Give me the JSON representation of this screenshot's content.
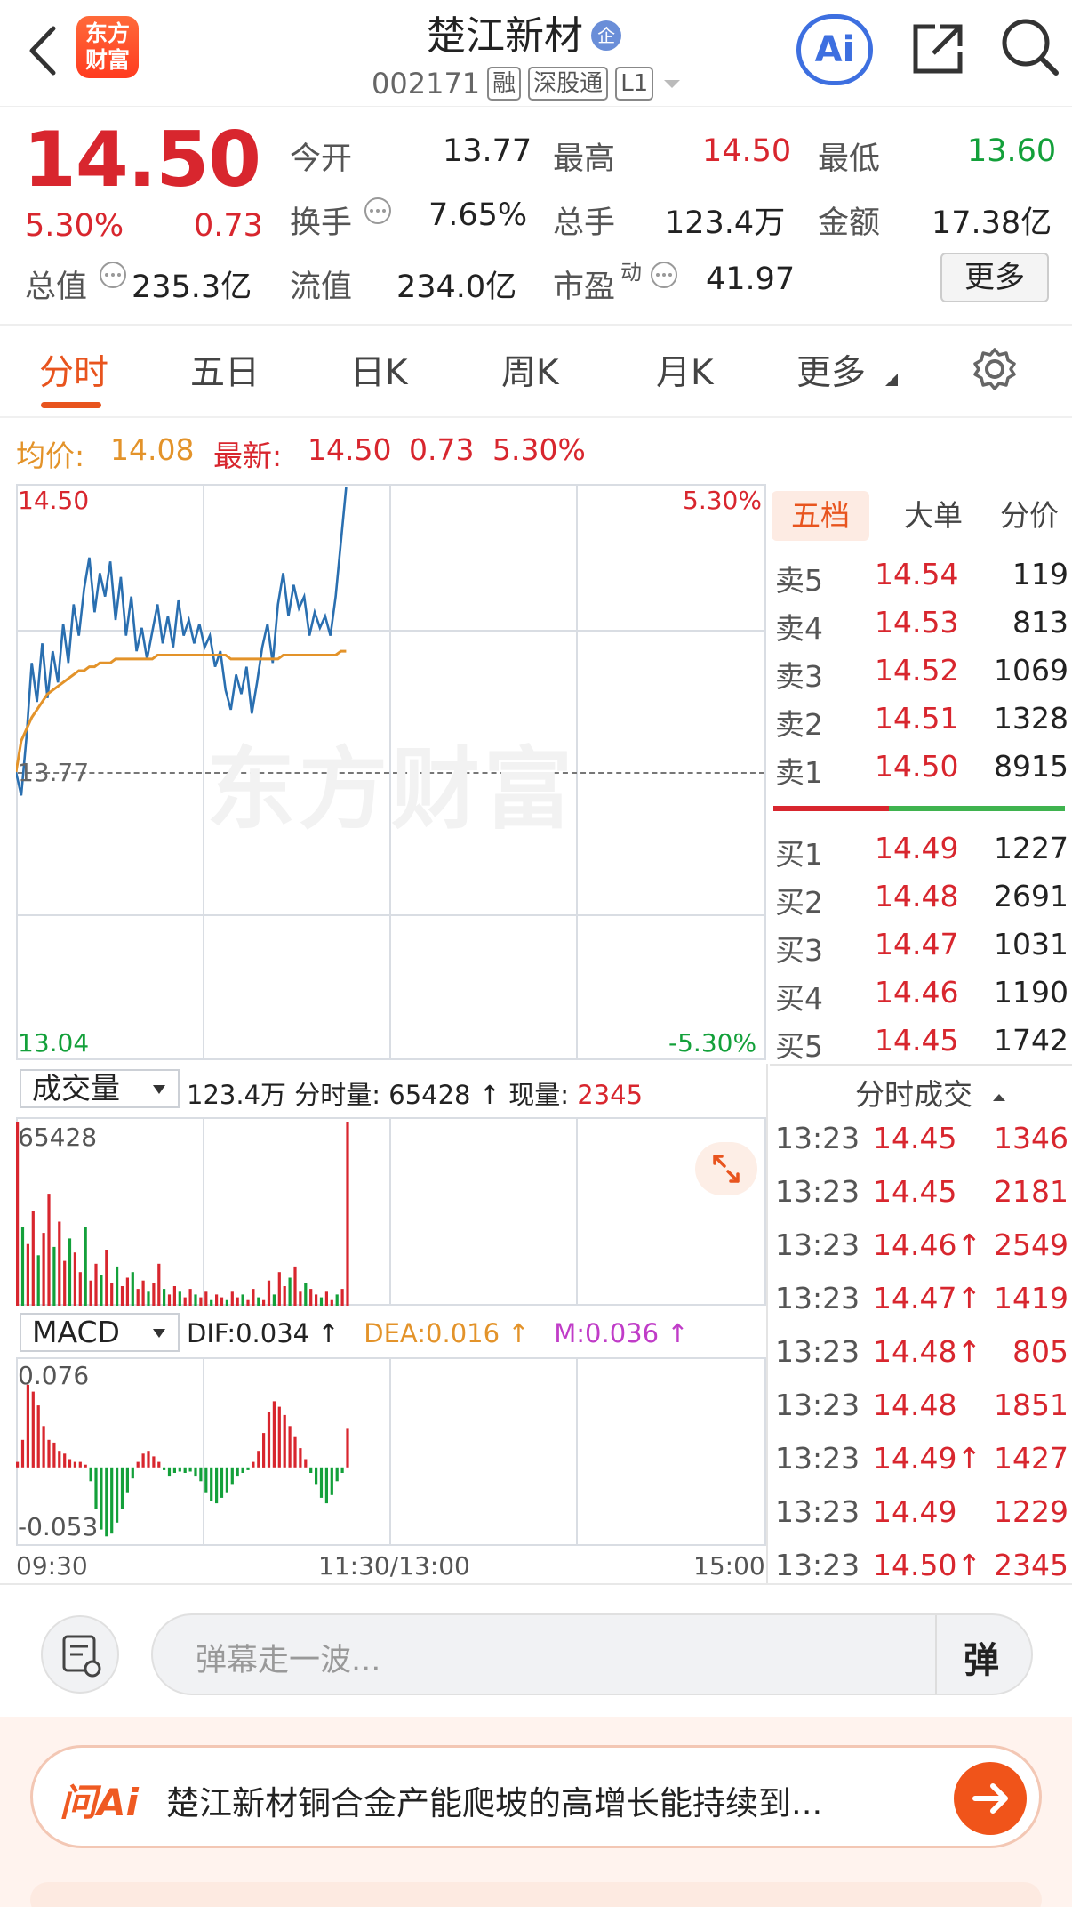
{
  "header": {
    "logo_text_line1": "东方",
    "logo_text_line2": "财富",
    "title": "楚江新材",
    "badge": "企",
    "code": "002171",
    "tags": [
      "融",
      "深股通",
      "L1"
    ],
    "ai_label": "Ai"
  },
  "quote": {
    "price": "14.50",
    "change_pct": "5.30%",
    "change": "0.73",
    "open_label": "今开",
    "open": "13.77",
    "high_label": "最高",
    "high": "14.50",
    "low_label": "最低",
    "low": "13.60",
    "turnover_label": "换手",
    "turnover": "7.65%",
    "volume_label": "总手",
    "volume": "123.4万",
    "amount_label": "金额",
    "amount": "17.38亿",
    "mktcap_label": "总值",
    "mktcap": "235.3亿",
    "float_label": "流值",
    "float": "234.0亿",
    "pe_label": "市盈",
    "pe_sup": "动",
    "pe": "41.97",
    "more_button": "更多"
  },
  "tabs": [
    "分时",
    "五日",
    "日K",
    "周K",
    "月K",
    "更多"
  ],
  "active_tab": "分时",
  "chart_header": {
    "avg_label": "均价:",
    "avg": "14.08",
    "latest_label": "最新:",
    "latest": "14.50",
    "chg": "0.73",
    "pct": "5.30%"
  },
  "chart_labels": {
    "top_price": "14.50",
    "top_pct": "5.30%",
    "mid_price": "13.77",
    "bottom_price": "13.04",
    "bottom_pct": "-5.30%",
    "watermark": "东方财富"
  },
  "colors": {
    "up": "#d8262e",
    "down": "#13a03a",
    "accent": "#e8541e",
    "price_line": "#2a6fb0",
    "avg_line": "#e3932a"
  },
  "chart_data": [
    {
      "type": "line",
      "title": "",
      "ylim": [
        13.04,
        14.5
      ],
      "x_range_labels": [
        "09:30",
        "11:30/13:00",
        "15:00"
      ],
      "series": [
        {
          "values": [
            13.77,
            13.71,
            13.86,
            14.05,
            13.95,
            14.1,
            13.96,
            14.08,
            14.0,
            14.15,
            14.05,
            14.2,
            14.12,
            14.24,
            14.32,
            14.18,
            14.28,
            14.22,
            14.31,
            14.16,
            14.27,
            14.12,
            14.22,
            14.08,
            14.14,
            14.06,
            14.13,
            14.2,
            14.1,
            14.17,
            14.09,
            14.21,
            14.12,
            14.16,
            14.1,
            14.15,
            14.09,
            14.12,
            14.04,
            14.08,
            13.98,
            13.93,
            14.02,
            13.97,
            14.04,
            13.92,
            14.0,
            14.09,
            14.15,
            14.05,
            14.2,
            14.28,
            14.17,
            14.25,
            14.19,
            14.22,
            14.12,
            14.18,
            14.14,
            14.17,
            14.12,
            14.22,
            14.36,
            14.5
          ]
        },
        {
          "values": [
            13.77,
            13.85,
            13.88,
            13.91,
            13.93,
            13.95,
            13.97,
            13.98,
            13.99,
            14.0,
            14.01,
            14.02,
            14.03,
            14.03,
            14.04,
            14.04,
            14.05,
            14.05,
            14.05,
            14.06,
            14.06,
            14.06,
            14.06,
            14.06,
            14.06,
            14.06,
            14.06,
            14.07,
            14.07,
            14.07,
            14.07,
            14.07,
            14.07,
            14.07,
            14.07,
            14.07,
            14.07,
            14.07,
            14.07,
            14.07,
            14.07,
            14.06,
            14.06,
            14.06,
            14.06,
            14.06,
            14.06,
            14.06,
            14.06,
            14.06,
            14.06,
            14.07,
            14.07,
            14.07,
            14.07,
            14.07,
            14.07,
            14.07,
            14.07,
            14.07,
            14.07,
            14.07,
            14.08,
            14.08
          ]
        }
      ]
    },
    {
      "type": "bar",
      "title": "",
      "ylim": [
        0,
        65428
      ],
      "values": [
        65428,
        28000,
        22000,
        34000,
        18000,
        26000,
        40000,
        21000,
        30000,
        16000,
        24000,
        19000,
        12000,
        28000,
        9000,
        15000,
        11000,
        20000,
        8000,
        14000,
        7000,
        10000,
        12000,
        6000,
        9000,
        5000,
        8000,
        15000,
        6000,
        4000,
        7000,
        5000,
        3000,
        6000,
        4000,
        3000,
        5000,
        2000,
        4000,
        3000,
        2000,
        5000,
        3000,
        4000,
        2000,
        6000,
        3000,
        2000,
        9000,
        4000,
        12000,
        7000,
        10000,
        14000,
        5000,
        8000,
        6000,
        4000,
        3000,
        5000,
        2000,
        4000,
        6000,
        65428
      ]
    },
    {
      "type": "bar",
      "title": "",
      "ylim": [
        -0.053,
        0.076
      ],
      "values": [
        0.004,
        0.02,
        0.06,
        0.055,
        0.045,
        0.03,
        0.02,
        0.018,
        0.012,
        0.01,
        0.006,
        0.004,
        0.004,
        0.002,
        -0.01,
        -0.03,
        -0.045,
        -0.05,
        -0.048,
        -0.04,
        -0.03,
        -0.018,
        -0.008,
        0.004,
        0.01,
        0.012,
        0.008,
        0.004,
        -0.002,
        -0.006,
        -0.004,
        -0.003,
        -0.004,
        -0.003,
        -0.006,
        -0.01,
        -0.018,
        -0.024,
        -0.026,
        -0.022,
        -0.018,
        -0.012,
        -0.006,
        -0.004,
        -0.002,
        0.004,
        0.012,
        0.025,
        0.04,
        0.048,
        0.044,
        0.038,
        0.03,
        0.022,
        0.014,
        0.006,
        -0.004,
        -0.012,
        -0.022,
        -0.026,
        -0.02,
        -0.01,
        -0.004,
        0.028
      ]
    }
  ],
  "volume_panel": {
    "select_label": "成交量",
    "total": "123.4万",
    "period_label": "分时量:",
    "period_value": "65428",
    "current_label": "现量:",
    "current_value": "2345",
    "max_label": "65428"
  },
  "macd_panel": {
    "select_label": "MACD",
    "dif": "DIF:0.034",
    "dea": "DEA:0.016",
    "m": "M:0.036",
    "top_label": "0.076",
    "bottom_label": "-0.053"
  },
  "time_axis": {
    "start": "09:30",
    "mid": "11:30/13:00",
    "end": "15:00"
  },
  "orderbook": {
    "tabs": [
      "五档",
      "大单",
      "分价"
    ],
    "sells": [
      {
        "label": "卖5",
        "price": "14.54",
        "vol": "119"
      },
      {
        "label": "卖4",
        "price": "14.53",
        "vol": "813"
      },
      {
        "label": "卖3",
        "price": "14.52",
        "vol": "1069"
      },
      {
        "label": "卖2",
        "price": "14.51",
        "vol": "1328"
      },
      {
        "label": "卖1",
        "price": "14.50",
        "vol": "8915"
      }
    ],
    "buys": [
      {
        "label": "买1",
        "price": "14.49",
        "vol": "1227"
      },
      {
        "label": "买2",
        "price": "14.48",
        "vol": "2691"
      },
      {
        "label": "买3",
        "price": "14.47",
        "vol": "1031"
      },
      {
        "label": "买4",
        "price": "14.46",
        "vol": "1190"
      },
      {
        "label": "买5",
        "price": "14.45",
        "vol": "1742"
      }
    ]
  },
  "trades": {
    "title": "分时成交",
    "rows": [
      {
        "time": "13:23",
        "price": "14.45",
        "vol": "1346"
      },
      {
        "time": "13:23",
        "price": "14.45",
        "vol": "2181"
      },
      {
        "time": "13:23",
        "price": "14.46↑",
        "vol": "2549"
      },
      {
        "time": "13:23",
        "price": "14.47↑",
        "vol": "1419"
      },
      {
        "time": "13:23",
        "price": "14.48↑",
        "vol": "805"
      },
      {
        "time": "13:23",
        "price": "14.48",
        "vol": "1851"
      },
      {
        "time": "13:23",
        "price": "14.49↑",
        "vol": "1427"
      },
      {
        "time": "13:23",
        "price": "14.49",
        "vol": "1229"
      },
      {
        "time": "13:23",
        "price": "14.50↑",
        "vol": "2345"
      }
    ]
  },
  "comment_bar": {
    "placeholder": "弹幕走一波...",
    "send_label": "弹"
  },
  "ai_banner": {
    "logo": "问Ai",
    "text": "楚江新材铜合金产能爬坡的高增长能持续到..."
  }
}
